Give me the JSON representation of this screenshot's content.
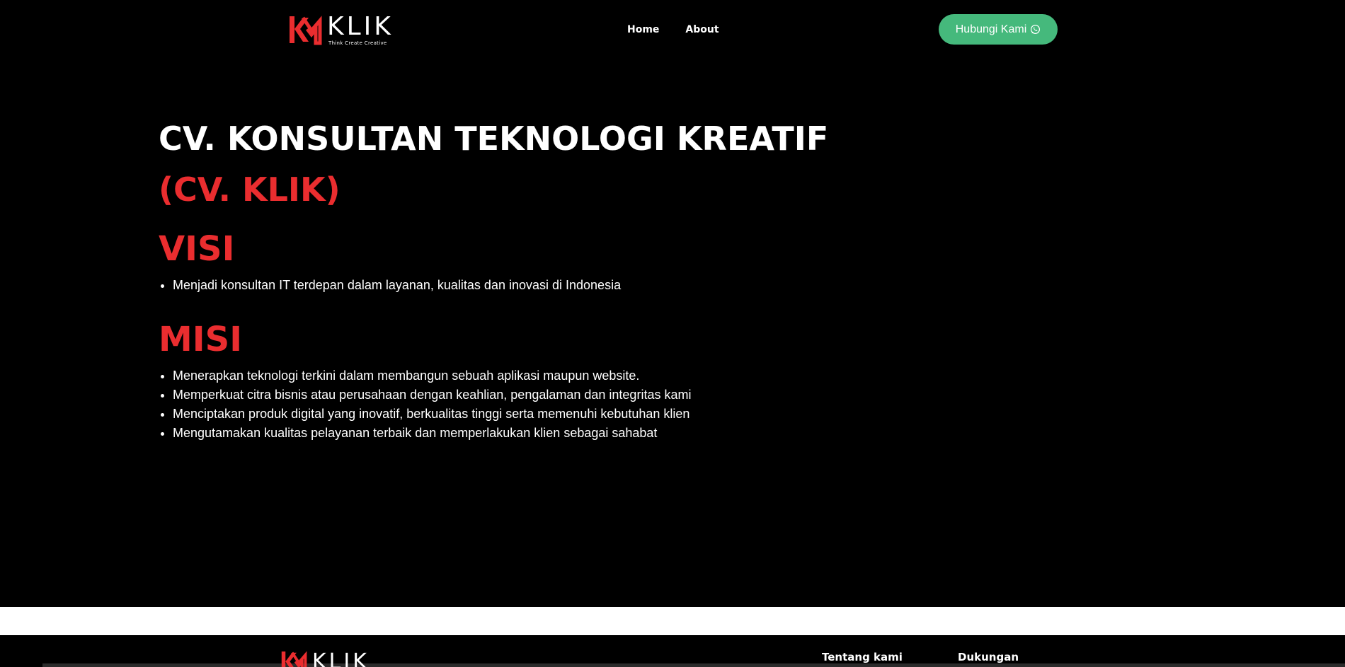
{
  "header": {
    "logo": {
      "word": "KLIK",
      "tagline": "Think Create Creative"
    },
    "nav": [
      {
        "label": "Home"
      },
      {
        "label": "About"
      }
    ],
    "cta": {
      "label": "Hubungi Kami",
      "icon": "whatsapp-icon",
      "color": "#45b97c"
    }
  },
  "main": {
    "title": "CV. KONSULTAN TEKNOLOGI KREATIF",
    "title_short": "(CV. KLIK)",
    "accent_color": "#ea2d2f",
    "visi": {
      "title": "VISI",
      "items": [
        "Menjadi konsultan IT terdepan dalam layanan, kualitas dan inovasi di Indonesia"
      ]
    },
    "misi": {
      "title": "MISI",
      "items": [
        "Menerapkan teknologi terkini dalam membangun sebuah aplikasi maupun website.",
        "Memperkuat citra bisnis atau perusahaan dengan keahlian, pengalaman dan integritas kami",
        "Menciptakan produk digital yang inovatif, berkualitas tinggi serta memenuhi kebutuhan klien",
        "Mengutamakan kualitas pelayanan terbaik dan memperlakukan klien sebagai sahabat"
      ]
    }
  },
  "footer": {
    "logo": {
      "word": "KLIK"
    },
    "columns": [
      {
        "title": "Tentang kami"
      },
      {
        "title": "Dukungan"
      }
    ]
  }
}
